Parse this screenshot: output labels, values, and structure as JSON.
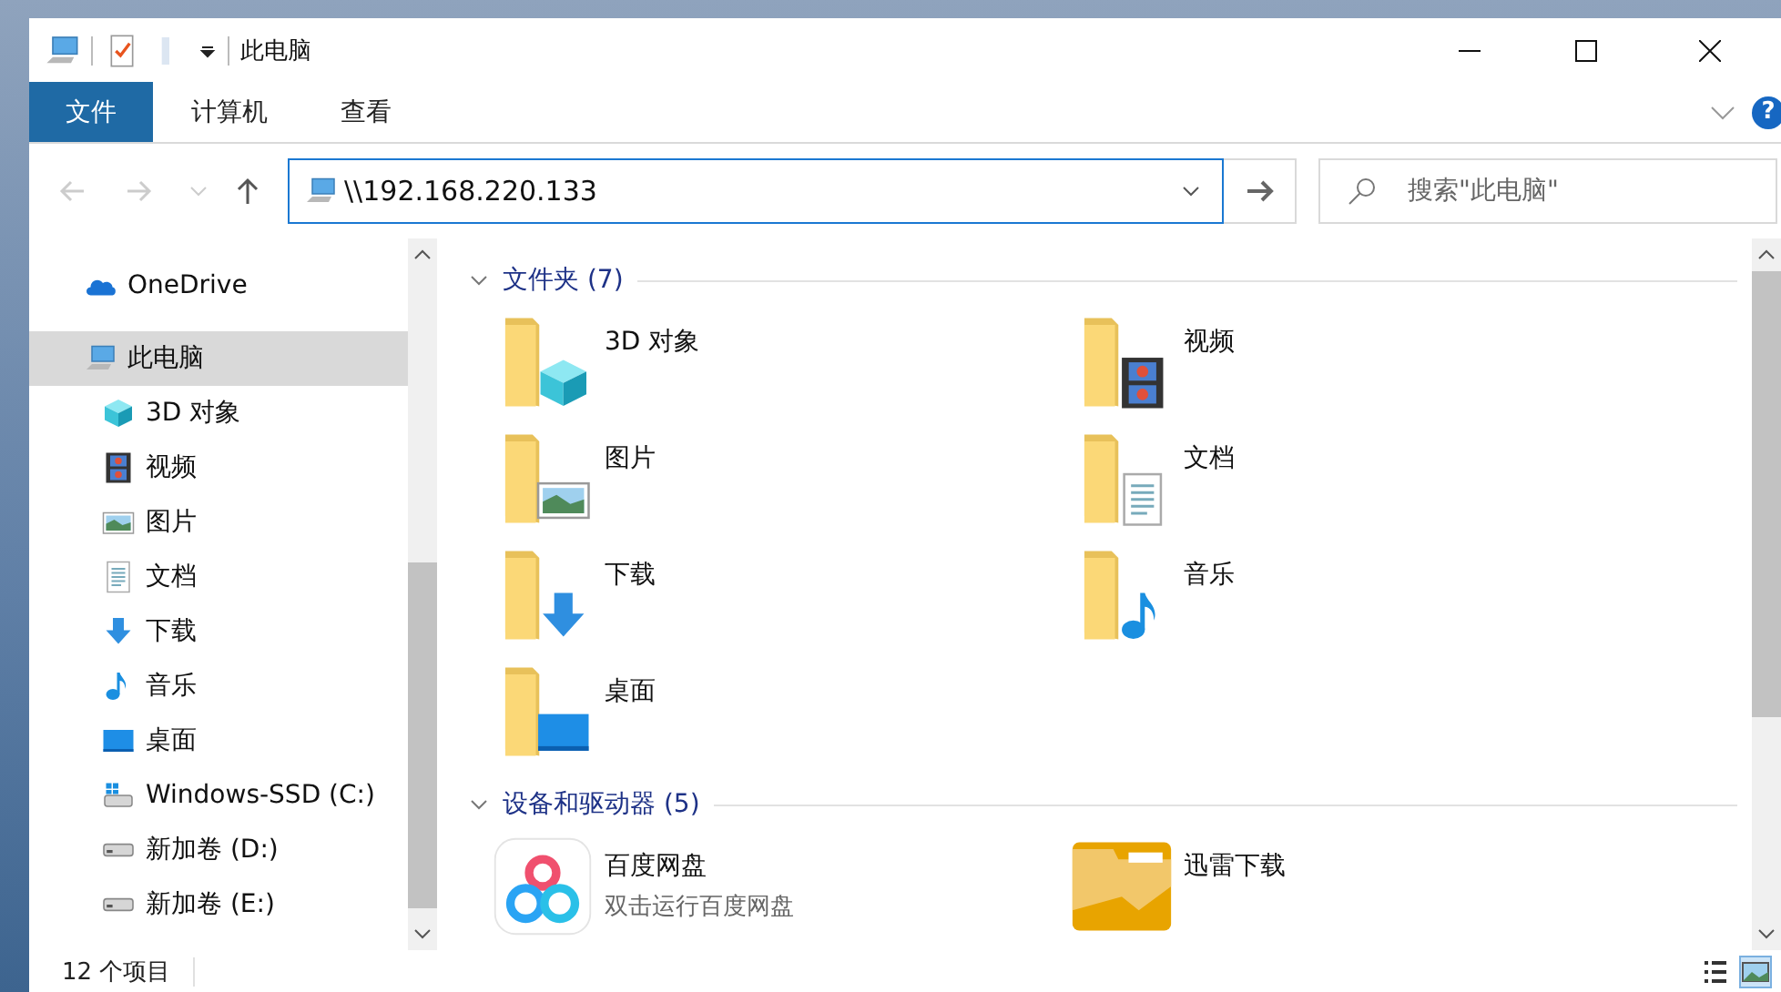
{
  "window": {
    "title": "此电脑"
  },
  "ribbon": {
    "tabs": [
      {
        "label": "文件",
        "selected": true
      },
      {
        "label": "计算机",
        "selected": false
      },
      {
        "label": "查看",
        "selected": false
      }
    ],
    "help": "?"
  },
  "address_bar": {
    "value": "\\\\192.168.220.133"
  },
  "search": {
    "placeholder": "搜索\"此电脑\""
  },
  "sidebar": {
    "items": [
      {
        "label": "OneDrive",
        "kind": "onedrive",
        "selected": false
      },
      {
        "label": "此电脑",
        "kind": "pc",
        "selected": true,
        "children": [
          {
            "label": "3D 对象",
            "kind": "cube",
            "selected": false
          },
          {
            "label": "视频",
            "kind": "video",
            "selected": false
          },
          {
            "label": "图片",
            "kind": "pictures",
            "selected": false
          },
          {
            "label": "文档",
            "kind": "docs",
            "selected": false
          },
          {
            "label": "下载",
            "kind": "downloads",
            "selected": false
          },
          {
            "label": "音乐",
            "kind": "music",
            "selected": false
          },
          {
            "label": "桌面",
            "kind": "desktop",
            "selected": false
          },
          {
            "label": "Windows-SSD (C:)",
            "kind": "windrive",
            "selected": false
          },
          {
            "label": "新加卷 (D:)",
            "kind": "drive",
            "selected": false
          },
          {
            "label": "新加卷 (E:)",
            "kind": "drive",
            "selected": false
          }
        ]
      }
    ]
  },
  "content": {
    "groups": [
      {
        "title": "文件夹 (7)",
        "items": [
          {
            "name": "3D 对象",
            "kind": "cube"
          },
          {
            "name": "视频",
            "kind": "video"
          },
          {
            "name": "图片",
            "kind": "pictures"
          },
          {
            "name": "文档",
            "kind": "docs"
          },
          {
            "name": "下载",
            "kind": "downloads"
          },
          {
            "name": "音乐",
            "kind": "music"
          },
          {
            "name": "桌面",
            "kind": "desktop"
          }
        ]
      },
      {
        "title": "设备和驱动器 (5)",
        "items": [
          {
            "name": "百度网盘",
            "subtitle": "双击运行百度网盘",
            "kind": "baidu"
          },
          {
            "name": "迅雷下载",
            "kind": "xunlei"
          }
        ]
      }
    ]
  },
  "status_bar": {
    "count": "12 个项目"
  }
}
